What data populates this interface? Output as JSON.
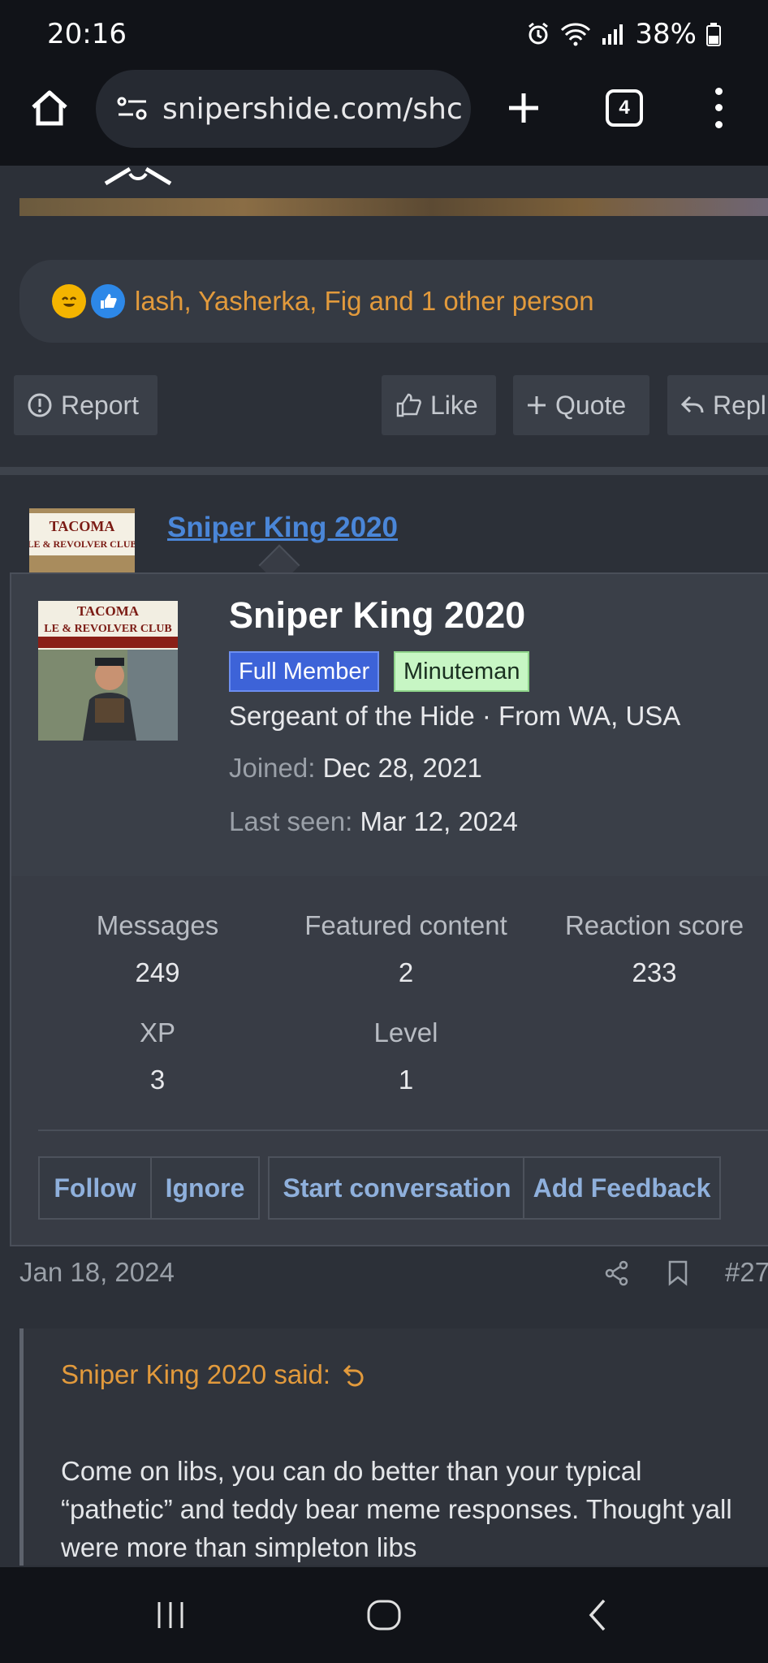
{
  "status": {
    "time": "20:16",
    "battery": "38%"
  },
  "browser": {
    "url": "snipershide.com/shc",
    "tab_count": "4"
  },
  "reactions": {
    "text": "lash, Yasherka, Fig and 1 other person"
  },
  "post_actions": {
    "report": "Report",
    "like": "Like",
    "quote": "Quote",
    "reply": "Repl"
  },
  "post": {
    "username": "Sniper King 2020",
    "date": "Jan 18, 2024",
    "number": "#27"
  },
  "popup": {
    "name": "Sniper King 2020",
    "badge_full": "Full Member",
    "badge_minute": "Minuteman",
    "title_line": "Sergeant of the Hide · From WA, USA",
    "joined_label": "Joined:",
    "joined_value": "Dec 28, 2021",
    "last_seen_label": "Last seen:",
    "last_seen_value": "Mar 12, 2024",
    "stats": {
      "messages_label": "Messages",
      "messages_value": "249",
      "featured_label": "Featured content",
      "featured_value": "2",
      "reaction_label": "Reaction score",
      "reaction_value": "233",
      "xp_label": "XP",
      "xp_value": "3",
      "level_label": "Level",
      "level_value": "1"
    },
    "buttons": {
      "follow": "Follow",
      "ignore": "Ignore",
      "start": "Start conversation",
      "feedback": "Add Feedback"
    },
    "avatar_sign": "TACOMA",
    "avatar_sign2": "LE & REVOLVER CLUB"
  },
  "quote": {
    "author": "Sniper King 2020 said:",
    "text": "Come on libs, you can do better than your typical “pathetic” and teddy bear meme responses. Thought yall were more than simpleton libs"
  },
  "colors": {
    "accent_orange": "#e29a3c",
    "link_blue": "#4a86d8",
    "badge_blue": "#3d63d8",
    "badge_green": "#c7f6c4"
  }
}
